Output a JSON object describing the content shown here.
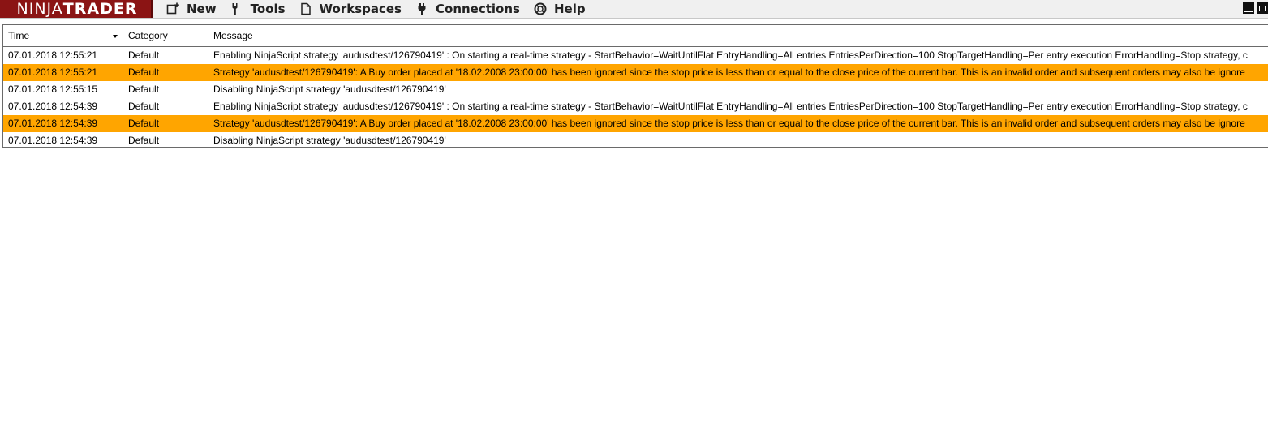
{
  "app": {
    "logo_light": "NINJA",
    "logo_bold": "TRADER"
  },
  "menu": [
    {
      "label": "New",
      "icon": "new-window-icon"
    },
    {
      "label": "Tools",
      "icon": "wrench-icon"
    },
    {
      "label": "Workspaces",
      "icon": "document-icon"
    },
    {
      "label": "Connections",
      "icon": "plug-icon"
    },
    {
      "label": "Help",
      "icon": "lifebuoy-icon"
    }
  ],
  "grid": {
    "columns": {
      "time": "Time",
      "category": "Category",
      "message": "Message"
    },
    "rows": [
      {
        "time": "07.01.2018 12:55:21",
        "category": "Default",
        "message": "Enabling NinjaScript strategy 'audusdtest/126790419' : On starting a real-time strategy - StartBehavior=WaitUntilFlat EntryHandling=All entries EntriesPerDirection=100 StopTargetHandling=Per entry execution ErrorHandling=Stop strategy, c",
        "highlight": false
      },
      {
        "time": "07.01.2018 12:55:21",
        "category": "Default",
        "message": "Strategy 'audusdtest/126790419': A Buy order placed at '18.02.2008 23:00:00' has been ignored since the stop price is less than or equal to the close price of the current bar. This is an invalid order and subsequent orders may also be ignore",
        "highlight": true
      },
      {
        "time": "07.01.2018 12:55:15",
        "category": "Default",
        "message": "Disabling NinjaScript strategy 'audusdtest/126790419'",
        "highlight": false
      },
      {
        "time": "07.01.2018 12:54:39",
        "category": "Default",
        "message": "Enabling NinjaScript strategy 'audusdtest/126790419' : On starting a real-time strategy - StartBehavior=WaitUntilFlat EntryHandling=All entries EntriesPerDirection=100 StopTargetHandling=Per entry execution ErrorHandling=Stop strategy, c",
        "highlight": false
      },
      {
        "time": "07.01.2018 12:54:39",
        "category": "Default",
        "message": "Strategy 'audusdtest/126790419': A Buy order placed at '18.02.2008 23:00:00' has been ignored since the stop price is less than or equal to the close price of the current bar. This is an invalid order and subsequent orders may also be ignore",
        "highlight": true
      },
      {
        "time": "07.01.2018 12:54:39",
        "category": "Default",
        "message": "Disabling NinjaScript strategy 'audusdtest/126790419'",
        "highlight": false
      }
    ]
  },
  "colors": {
    "logo_bg": "#8b1414",
    "warning_row": "#ffa500"
  }
}
